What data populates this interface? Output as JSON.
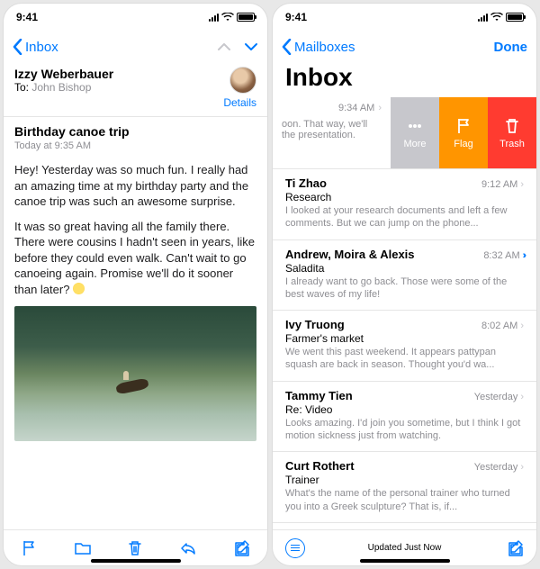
{
  "status": {
    "time": "9:41"
  },
  "left": {
    "back": "Inbox",
    "sender": "Izzy Weberbauer",
    "to_prefix": "To:",
    "to_name": "John Bishop",
    "details": "Details",
    "subject": "Birthday canoe trip",
    "timestamp": "Today at 9:35 AM",
    "para1": "Hey! Yesterday was so much fun. I really had an amazing time at my birthday party and the canoe trip was such an awesome surprise.",
    "para2": "It was so great having all the family there. There were cousins I hadn't seen in years, like before they could even walk. Can't wait to go canoeing again. Promise we'll do it sooner than later? "
  },
  "right": {
    "back": "Mailboxes",
    "done": "Done",
    "title": "Inbox",
    "swiped": {
      "time": "9:34 AM",
      "preview": "oon. That way, we'll\nthe presentation.",
      "more": "More",
      "flag": "Flag",
      "trash": "Trash"
    },
    "messages": [
      {
        "from": "Ti Zhao",
        "time": "9:12 AM",
        "subject": "Research",
        "preview": "I looked at your research documents and left a few comments. But we can jump on the phone...",
        "marker": "chev"
      },
      {
        "from": "Andrew, Moira & Alexis",
        "time": "8:32 AM",
        "subject": "Saladita",
        "preview": "I already want to go back. Those were some of the best waves of my life!",
        "marker": "forward"
      },
      {
        "from": "Ivy Truong",
        "time": "8:02 AM",
        "subject": "Farmer's market",
        "preview": "We went this past weekend. It appears pattypan squash are back in season. Thought you'd wa...",
        "marker": "chev"
      },
      {
        "from": "Tammy Tien",
        "time": "Yesterday",
        "subject": "Re: Video",
        "preview": "Looks amazing. I'd join you sometime, but I think I got motion sickness just from watching.",
        "marker": "chev"
      },
      {
        "from": "Curt Rothert",
        "time": "Yesterday",
        "subject": "Trainer",
        "preview": "What's the name of the personal trainer who turned you into a Greek sculpture? That is, if...",
        "marker": "chev"
      }
    ],
    "updated": "Updated Just Now"
  }
}
